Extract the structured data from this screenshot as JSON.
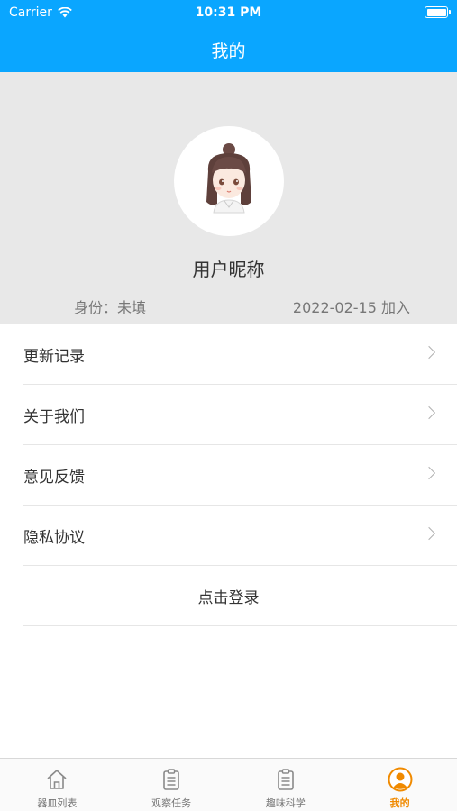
{
  "status_bar": {
    "carrier": "Carrier",
    "time": "10:31 PM"
  },
  "nav": {
    "title": "我的"
  },
  "profile": {
    "nickname": "用户昵称",
    "identity": "身份：未填",
    "joined": "2022-02-15 加入"
  },
  "menu": {
    "items": [
      {
        "label": "更新记录"
      },
      {
        "label": "关于我们"
      },
      {
        "label": "意见反馈"
      },
      {
        "label": "隐私协议"
      }
    ],
    "login_label": "点击登录"
  },
  "tabbar": {
    "tabs": [
      {
        "label": "器皿列表",
        "icon": "home-icon"
      },
      {
        "label": "观察任务",
        "icon": "clipboard-icon"
      },
      {
        "label": "趣味科学",
        "icon": "clipboard-icon"
      },
      {
        "label": "我的",
        "icon": "user-icon"
      }
    ]
  },
  "colors": {
    "accent": "#0aa6ff",
    "active_tab": "#f08a00",
    "header_bg": "#e8e8e8"
  }
}
